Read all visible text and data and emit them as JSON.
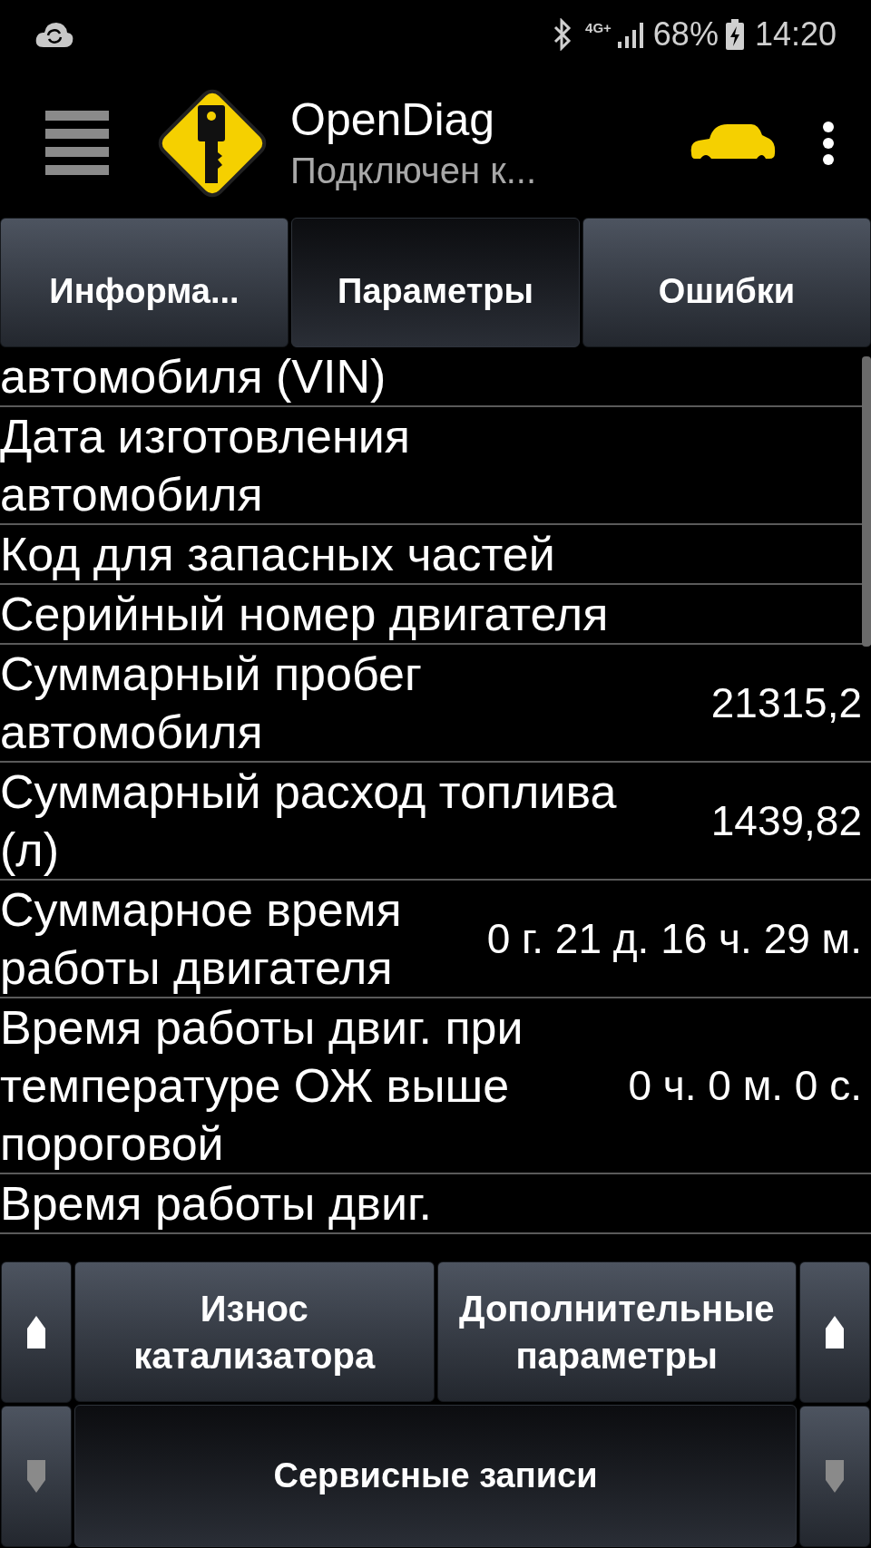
{
  "status_bar": {
    "network": "4G+",
    "battery": "68%",
    "time": "14:20"
  },
  "app_bar": {
    "title": "OpenDiag",
    "subtitle": "Подключен к..."
  },
  "tabs": [
    {
      "label": "Информа...",
      "selected": false
    },
    {
      "label": "Параметры",
      "selected": true
    },
    {
      "label": "Ошибки",
      "selected": false
    }
  ],
  "rows": [
    {
      "label": "автомобиля (VIN)"
    },
    {
      "label": "Дата изготовления автомобиля"
    },
    {
      "label": "Код для запасных частей"
    },
    {
      "label": "Серийный номер двигателя"
    },
    {
      "label": "Суммарный пробег автомобиля",
      "value": "21315,2"
    },
    {
      "label": "Суммарный расход топлива (л)",
      "value": "1439,82"
    },
    {
      "label": "Суммарное время работы двигателя",
      "value": "0 г. 21 д. 16 ч. 29 м."
    },
    {
      "label": "Время работы двиг. при температуре ОЖ выше пороговой",
      "value": "0 ч. 0 м. 0 с."
    },
    {
      "label": "Время работы двиг."
    }
  ],
  "bottom_buttons": [
    {
      "label": "Износ катализатора",
      "selected": false
    },
    {
      "label": "Дополнительные параметры",
      "selected": false
    },
    {
      "label": "Сервисные записи",
      "selected": true
    }
  ],
  "arrows": {
    "left": [
      {
        "kind": "up",
        "disabled": false
      },
      {
        "kind": "down",
        "disabled": true
      }
    ],
    "right": [
      {
        "kind": "up",
        "disabled": false
      },
      {
        "kind": "down",
        "disabled": true
      }
    ]
  }
}
